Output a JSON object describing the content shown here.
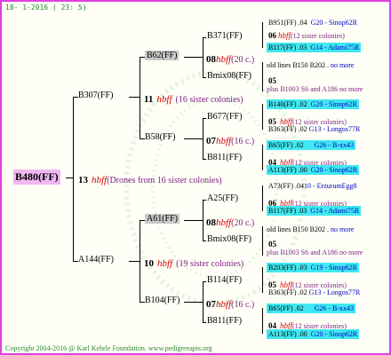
{
  "header": {
    "date": "18- 1-2016 ( 23: 5)"
  },
  "footer": {
    "copyright": "Copyright 2004-2016 @ Karl Kehrle Foundation.   www.pedigreeapis.org"
  },
  "root": {
    "id": "B480(FF)",
    "num": "13",
    "hbff": "hbff",
    "note": "(Drones from 16 sister colonies)"
  },
  "gen1": [
    {
      "id": "B307(FF)",
      "num": "11",
      "hbff": "hbff",
      "note": "(16 sister colonies)"
    },
    {
      "id": "A144(FF)",
      "num": "10",
      "hbff": "hbff",
      "note": "(19 sister colonies)"
    }
  ],
  "gen2": [
    {
      "id": "B62(FF)",
      "num": "08",
      "hbff": "hbff",
      "note": "(20 c.)"
    },
    {
      "id": "B58(FF)",
      "num": "07",
      "hbff": "hbff",
      "note": "(16 c.)"
    },
    {
      "id": "A61(FF)",
      "num": "08",
      "hbff": "hbff",
      "note": "(20 c.)"
    },
    {
      "id": "B104(FF)",
      "num": "07",
      "hbff": "hbff",
      "note": "(16 c.)"
    }
  ],
  "gen3": [
    {
      "id": "B371(FF)",
      "num": "06",
      "hbff": "hbff",
      "note": "(12 sister colonies)"
    },
    {
      "id": "Bmix08(FF)",
      "num": "05",
      "note": ""
    },
    {
      "id": "B677(FF)",
      "num": "05",
      "hbff": "hbff",
      "note": "(12 sister colonies)"
    },
    {
      "id": "B811(FF)",
      "num": "04",
      "hbff": "hbff",
      "note": "(12 sister colonies)"
    },
    {
      "id": "A25(FF)",
      "num": "06",
      "hbff": "hbff",
      "note": "(12 sister colonies)"
    },
    {
      "id": "Bmix08(FF)",
      "num": "05",
      "note": ""
    },
    {
      "id": "B114(FF)",
      "num": "05",
      "hbff": "hbff",
      "note": "(12 sister colonies)"
    },
    {
      "id": "B811(FF)",
      "num": "04",
      "hbff": "hbff",
      "note": "(12 sister colonies)"
    }
  ],
  "leaves": [
    {
      "a": "B951(FF)",
      "b": ".04",
      "c": "G20 - Sinop62R"
    },
    {
      "a": "B117(FF)",
      "b": ".03",
      "c": "G14 - Adami75R"
    },
    {
      "a": "old lines B150 B202",
      "b": "",
      "c": ". no more"
    },
    {
      "a": "plus B1003 S6 and A186",
      "b": "",
      "c": "no more"
    },
    {
      "a": "B140(FF)",
      "b": ".02",
      "c": "G20 - Sinop62R"
    },
    {
      "a": "B363(FF)",
      "b": ".02",
      "c": "G13 - Longos77R"
    },
    {
      "a": "B65(FF)",
      "b": ".02",
      "c": "G26 - B-xx43"
    },
    {
      "a": "A113(FF)",
      "b": ".00",
      "c": "G20 - Sinop62R"
    },
    {
      "a": "A73(FF)",
      "b": ".04",
      "c": "10 - ErzurumEgg8"
    },
    {
      "a": "B117(FF)",
      "b": ".03",
      "c": "G14 - Adami75R"
    },
    {
      "a": "old lines B150 B202",
      "b": "",
      "c": ". no more"
    },
    {
      "a": "plus B1003 S6 and A186",
      "b": "",
      "c": "no more"
    },
    {
      "a": "B203(FF)",
      "b": ".03",
      "c": "G19 - Sinop62R"
    },
    {
      "a": "B363(FF)",
      "b": ".02",
      "c": "G13 - Longos77R"
    },
    {
      "a": "B65(FF)",
      "b": ".02",
      "c": "G26 - B-xx43"
    },
    {
      "a": "A113(FF)",
      "b": ".00",
      "c": "G20 - Sinop62R"
    }
  ]
}
